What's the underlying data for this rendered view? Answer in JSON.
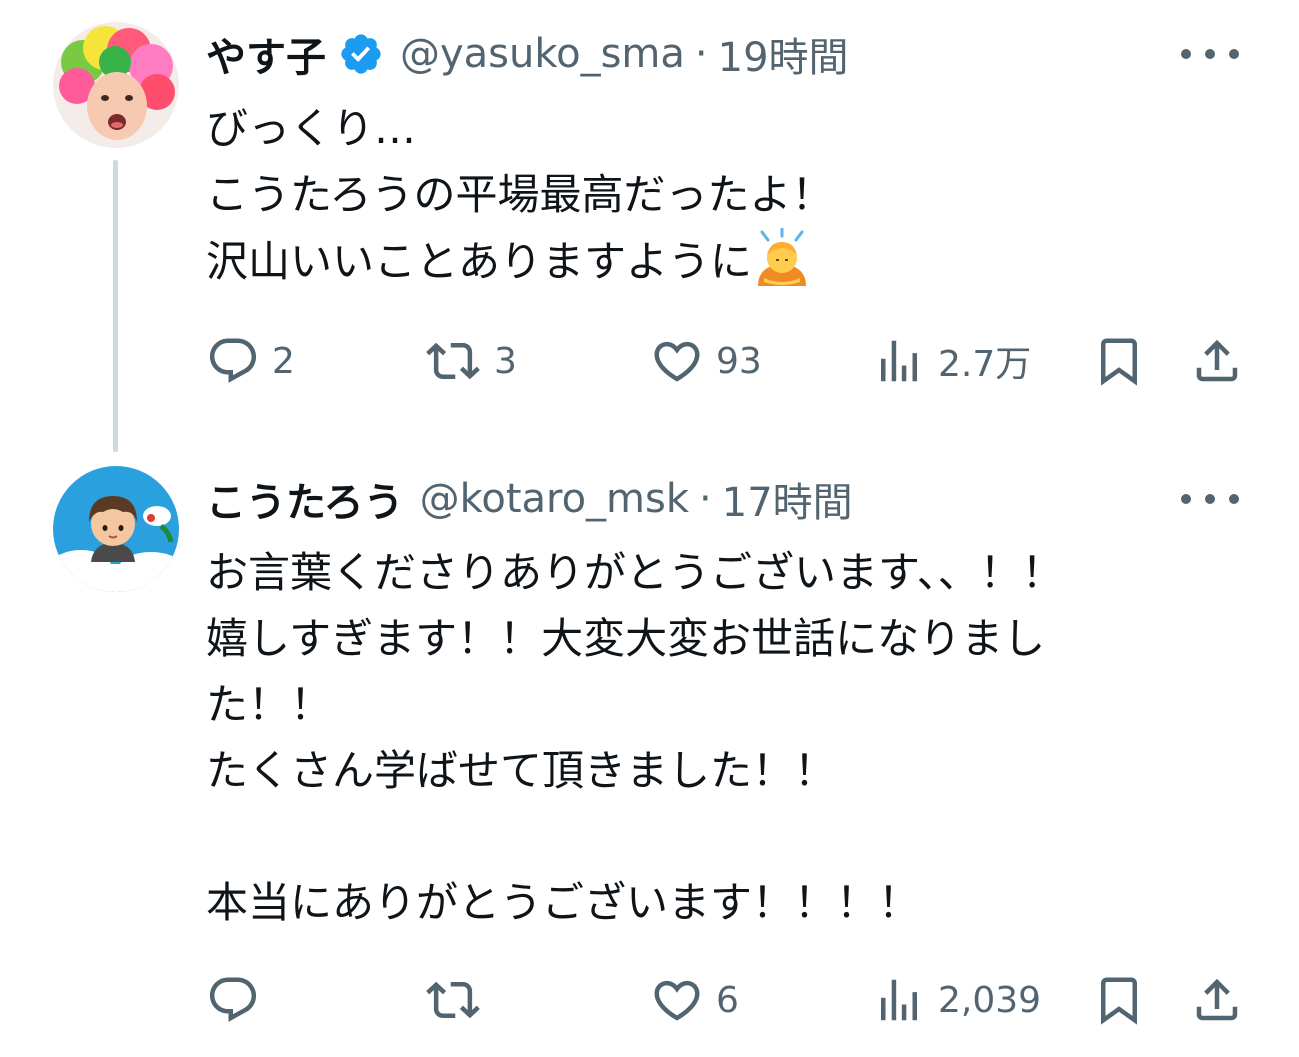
{
  "tweets": [
    {
      "display_name": "やす子",
      "verified": true,
      "handle": "@yasuko_sma",
      "separator": "·",
      "time": "19時間",
      "lines": [
        "びっくり…",
        "こうたろうの平場最高だったよ！",
        "沢山いいことありますように"
      ],
      "emoji_icon": "person-bowing-emoji",
      "actions": {
        "reply_count": "2",
        "retweet_count": "3",
        "like_count": "93",
        "view_count": "2.7万"
      }
    },
    {
      "display_name": "こうたろう",
      "verified": false,
      "handle": "@kotaro_msk",
      "separator": "·",
      "time": "17時間",
      "lines": [
        "お言葉くださりありがとうございます、、！！",
        "嬉しすぎます！！大変大変お世話になりまし",
        "た！！",
        "たくさん学ばせて頂きました！！",
        "",
        "本当にありがとうございます！！！！"
      ],
      "actions": {
        "reply_count": "",
        "retweet_count": "",
        "like_count": "6",
        "view_count": "2,039"
      }
    }
  ],
  "colors": {
    "text": "#0f1419",
    "secondary": "#536471",
    "verified_blue": "#1d9bf0",
    "thread_line": "#cfd9de"
  },
  "icons": {
    "reply": "reply-icon",
    "retweet": "retweet-icon",
    "like": "like-icon",
    "views": "views-icon",
    "bookmark": "bookmark-icon",
    "share": "share-icon",
    "more": "more-icon",
    "verified": "verified-badge-icon"
  }
}
